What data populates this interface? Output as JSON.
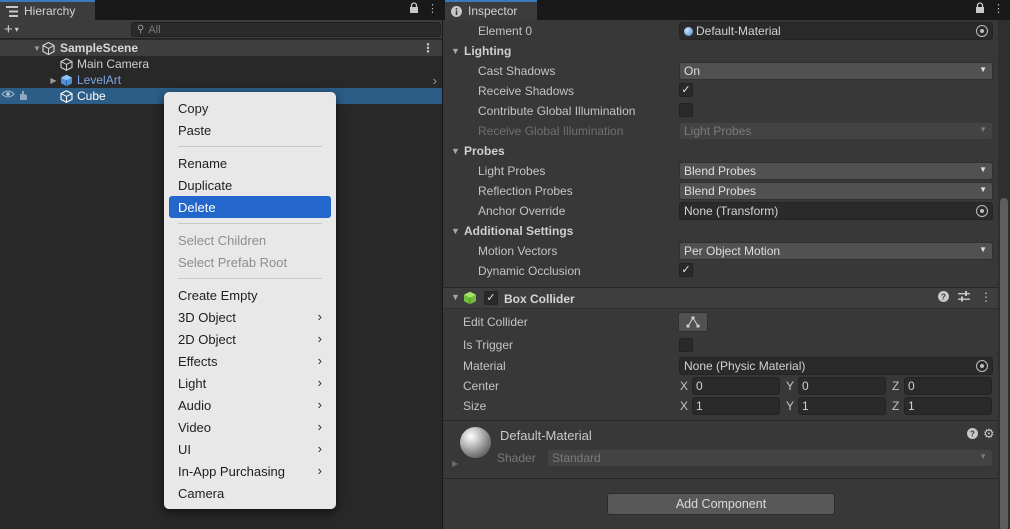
{
  "hierarchy": {
    "tab_title": "Hierarchy",
    "search_placeholder": "All",
    "scene_name": "SampleScene",
    "items": [
      {
        "label": "Main Camera"
      },
      {
        "label": "LevelArt"
      },
      {
        "label": "Cube"
      }
    ]
  },
  "context_menu": {
    "items": [
      {
        "label": "Copy"
      },
      {
        "label": "Paste"
      },
      {
        "label": "Rename"
      },
      {
        "label": "Duplicate"
      },
      {
        "label": "Delete"
      },
      {
        "label": "Select Children"
      },
      {
        "label": "Select Prefab Root"
      },
      {
        "label": "Create Empty"
      },
      {
        "label": "3D Object"
      },
      {
        "label": "2D Object"
      },
      {
        "label": "Effects"
      },
      {
        "label": "Light"
      },
      {
        "label": "Audio"
      },
      {
        "label": "Video"
      },
      {
        "label": "UI"
      },
      {
        "label": "In-App Purchasing"
      },
      {
        "label": "Camera"
      }
    ],
    "highlighted": "Delete"
  },
  "inspector": {
    "tab_title": "Inspector",
    "element0_label": "Element 0",
    "element0_value": "Default-Material",
    "lighting": {
      "header": "Lighting",
      "cast_shadows_label": "Cast Shadows",
      "cast_shadows_value": "On",
      "receive_shadows_label": "Receive Shadows",
      "contribute_gi_label": "Contribute Global Illumination",
      "receive_gi_label": "Receive Global Illumination",
      "receive_gi_value": "Light Probes"
    },
    "probes": {
      "header": "Probes",
      "light_probes_label": "Light Probes",
      "light_probes_value": "Blend Probes",
      "reflection_probes_label": "Reflection Probes",
      "reflection_probes_value": "Blend Probes",
      "anchor_override_label": "Anchor Override",
      "anchor_override_value": "None (Transform)"
    },
    "additional": {
      "header": "Additional Settings",
      "motion_vectors_label": "Motion Vectors",
      "motion_vectors_value": "Per Object Motion",
      "dynamic_occlusion_label": "Dynamic Occlusion"
    },
    "box_collider": {
      "title": "Box Collider",
      "edit_collider_label": "Edit Collider",
      "is_trigger_label": "Is Trigger",
      "material_label": "Material",
      "material_value": "None (Physic Material)",
      "center_label": "Center",
      "center": {
        "x": "0",
        "y": "0",
        "z": "0"
      },
      "size_label": "Size",
      "size": {
        "x": "1",
        "y": "1",
        "z": "1"
      },
      "axis_x": "X",
      "axis_y": "Y",
      "axis_z": "Z"
    },
    "material_preview": {
      "name": "Default-Material",
      "shader_label": "Shader",
      "shader_value": "Standard"
    },
    "add_component_label": "Add Component"
  },
  "colors": {
    "selection": "#2c5d87",
    "menu_highlight": "#2366cc",
    "prefab_text": "#7ba7e8"
  }
}
